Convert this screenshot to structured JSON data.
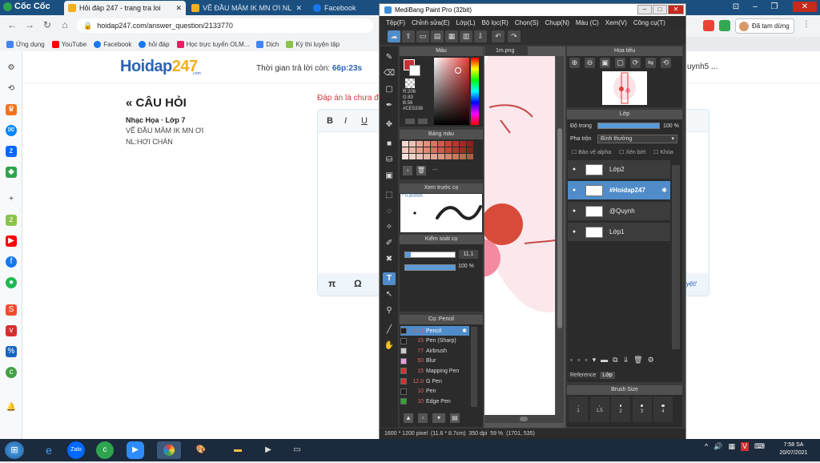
{
  "browser": {
    "brand": "Cốc Cốc",
    "tabs": [
      {
        "title": "Hỏi đáp 247 - trang tra loi",
        "active": true
      },
      {
        "title": "VẼ ĐẦU MĂM IK MN ƠI NL",
        "active": false
      },
      {
        "title": "Facebook",
        "active": false
      }
    ],
    "url": "hoidap247.com/answer_question/2133770",
    "bookmarks": [
      "Ứng dụng",
      "YouTube",
      "Facebook",
      "hỏi đáp",
      "Học trực tuyến OLM...",
      "Dịch",
      "Kỳ thi luyện tập"
    ],
    "profile_label": "Đã tạm dừng"
  },
  "site": {
    "logo_main": "Hoidap",
    "logo_num": "247",
    "logo_sub": ".com",
    "timer_label": "Thời gian trả lời còn:",
    "timer_value": "66p:23s",
    "user_trail": "uynh5 ...",
    "question_title": "« CÂU HỎI",
    "question_meta": "Nhạc Họa · Lớp 7",
    "question_lines": [
      "VẼ ĐẦU MĂM IK MN ƠI",
      "NL:HƠI CHÁN"
    ],
    "answer_hint": "Đáp án là chưa đ",
    "editor_tools": [
      "B",
      "I",
      "U"
    ],
    "editor_bottom": [
      "π",
      "Ω"
    ],
    "explain_link": "duyệt!"
  },
  "medibang": {
    "title": "MediBang Paint Pro (32bit)",
    "menu": [
      "Tệp(F)",
      "Chỉnh sửa(E)",
      "Lớp(L)",
      "Bộ lọc(R)",
      "Chọn(S)",
      "Chụp(N)",
      "Màu (C)",
      "Xem(V)",
      "Công cụ(T)"
    ],
    "color_panel": "Màu",
    "rgb": [
      "R:206",
      "G:83",
      "B:56",
      "#CE5338"
    ],
    "palette_panel": "Bảng màu",
    "palette_more": "---",
    "palette_colors": [
      "#f4d7cf",
      "#eec3b7",
      "#e7a898",
      "#e08f7d",
      "#d97563",
      "#d05c4c",
      "#c84337",
      "#b8352c",
      "#a32a24",
      "#8e201d",
      "#f2c9bd",
      "#e9b4a4",
      "#e3a08c",
      "#dc8b75",
      "#d2745f",
      "#c85f4b",
      "#be4a38",
      "#a93c2e",
      "#963126",
      "#82271f",
      "#f5e2dc",
      "#efd3c9",
      "#eac4b7",
      "#e4b5a4",
      "#dfa592",
      "#d99681",
      "#d3876f",
      "#c7785f",
      "#b96a52",
      "#a85d46"
    ],
    "preview_panel": "Xem trước cọ",
    "preview_size": "0.80mm",
    "control_panel": "Kiểm soát cọ",
    "size_value": "11.1",
    "opacity_value": "100 %",
    "size_fraction": 0.12,
    "opacity_fraction": 1.0,
    "brush_panel": "Cọ: Pencil",
    "brushes": [
      {
        "size": "11.1",
        "name": "Pencil",
        "color": "#1f1f1f",
        "selected": true
      },
      {
        "size": "15",
        "name": "Pen (Sharp)",
        "color": "#1f1f1f",
        "selected": false
      },
      {
        "size": "77",
        "name": "Airbrush",
        "color": "#cccccc",
        "selected": false
      },
      {
        "size": "50",
        "name": "Blur",
        "color": "#e7a0e0",
        "selected": false
      },
      {
        "size": "15",
        "name": "Mapping Pen",
        "color": "#d33232",
        "selected": false
      },
      {
        "size": "12.0",
        "name": "G Pen",
        "color": "#d33232",
        "selected": false
      },
      {
        "size": "10",
        "name": "Pen",
        "color": "#1f1f1f",
        "selected": false
      },
      {
        "size": "10",
        "name": "Edge Pen",
        "color": "#2fa82f",
        "selected": false
      }
    ],
    "canvas_tab": "1m.png",
    "navigator_panel": "Hoa tiêu",
    "layer_panel": "Lớp",
    "opacity_label": "Độ trong",
    "layer_opacity": "100 %",
    "blend_label": "Pha trộn",
    "blend_value": "Bình thường",
    "layer_checks": [
      "Bảo vệ alpha",
      "Xén bớt",
      "Khóa"
    ],
    "layers": [
      {
        "name": "Lớp2",
        "selected": false
      },
      {
        "name": "#Hoidap247",
        "selected": true
      },
      {
        "name": "@Quynh",
        "selected": false
      },
      {
        "name": "Lớp1",
        "selected": false
      }
    ],
    "bottom_tabs": [
      "Reference",
      "Lớp"
    ],
    "brush_size_panel": "Brush Size",
    "brush_sizes": [
      "1",
      "1.5",
      "2",
      "3",
      "4"
    ],
    "status": [
      "1600 * 1200 pixel",
      "(11.6 * 8.7cm)",
      "350 dpi",
      "59 %",
      "(1701, 535)"
    ]
  },
  "taskbar": {
    "clock_time": "7:58 SA",
    "clock_date": "20/07/2021"
  }
}
